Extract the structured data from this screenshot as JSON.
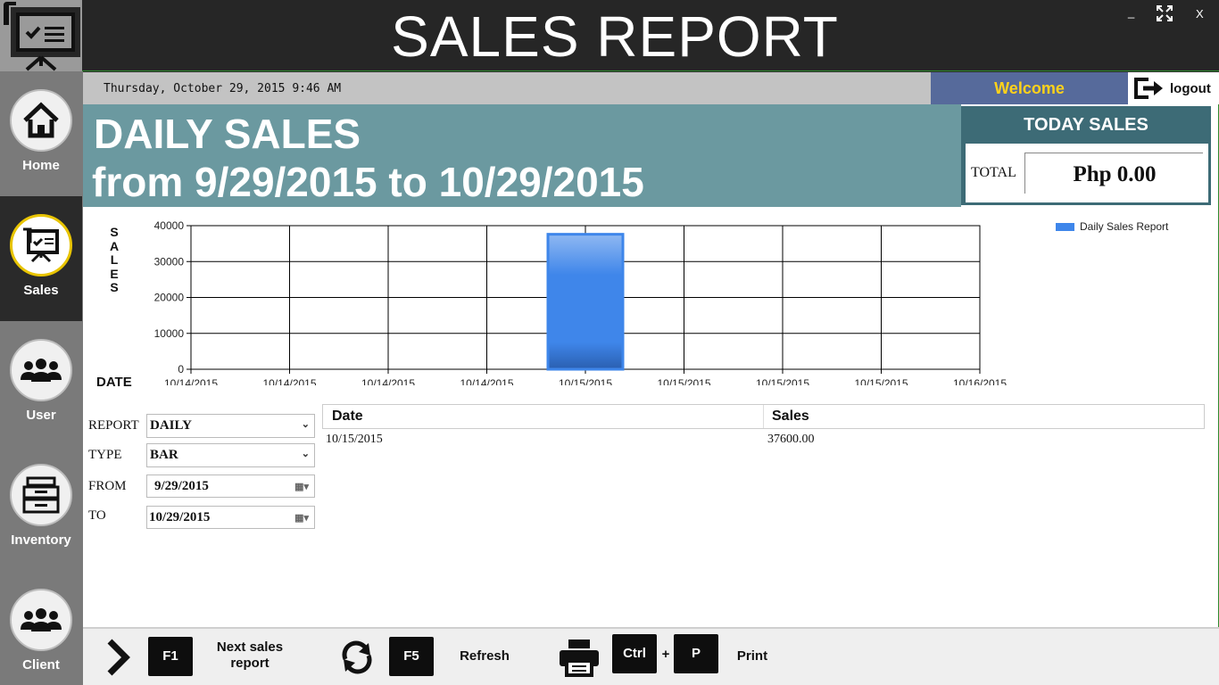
{
  "window": {
    "title": "SALES REPORT",
    "minimize": "_",
    "close": "X"
  },
  "sidebar": {
    "items": [
      {
        "label": "Home",
        "icon": "home-icon"
      },
      {
        "label": "Sales",
        "icon": "presentation-board-icon",
        "active": true
      },
      {
        "label": "User",
        "icon": "users-icon"
      },
      {
        "label": "Inventory",
        "icon": "inventory-drawer-icon"
      },
      {
        "label": "Client",
        "icon": "users-icon"
      }
    ]
  },
  "header": {
    "datetime": "Thursday, October 29, 2015 9:46 AM",
    "welcome": "Welcome",
    "logout": "logout"
  },
  "banner": {
    "title": "DAILY SALES",
    "range": "from 9/29/2015 to 10/29/2015"
  },
  "today_sales": {
    "title": "TODAY SALES",
    "total_label": "TOTAL",
    "total_value": "Php 0.00"
  },
  "chart_data": {
    "type": "bar",
    "ylabel_letters": [
      "S",
      "A",
      "L",
      "E",
      "S"
    ],
    "xlabel": "DATE",
    "yticks": [
      0,
      10000,
      20000,
      30000,
      40000
    ],
    "ylim": [
      0,
      40000
    ],
    "xtick_labels": [
      "10/14/2015",
      "10/14/2015",
      "10/14/2015",
      "10/14/2015",
      "10/15/2015",
      "10/15/2015",
      "10/15/2015",
      "10/15/2015",
      "10/16/2015"
    ],
    "x_range_days": [
      0,
      2
    ],
    "bars": [
      {
        "x_day": 1,
        "value": 37600
      }
    ],
    "legend": "Daily Sales Report",
    "grid": true,
    "legend_position": "top-right",
    "bar_color": "#3e86ea"
  },
  "form": {
    "report_label": "REPORT",
    "report_value": "DAILY",
    "type_label": "TYPE",
    "type_value": "BAR",
    "from_label": "FROM",
    "from_value": "9/29/2015",
    "to_label": "TO",
    "to_value": "10/29/2015"
  },
  "table": {
    "columns": [
      "Date",
      "Sales"
    ],
    "rows": [
      [
        "10/15/2015",
        "37600.00"
      ]
    ]
  },
  "footer": {
    "next_key": "F1",
    "next_label": "Next sales report",
    "refresh_key": "F5",
    "refresh_label": "Refresh",
    "ctrl_key": "Ctrl",
    "plus": "+",
    "p_key": "P",
    "print_label": "Print"
  }
}
